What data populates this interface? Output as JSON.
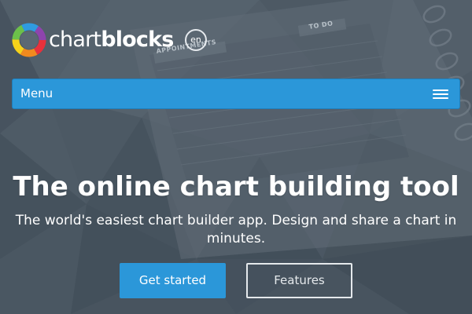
{
  "header": {
    "logo": {
      "text_light": "chart",
      "text_bold": "blocks"
    },
    "language": "en"
  },
  "menu": {
    "label": "Menu",
    "toggle_icon": "hamburger-icon"
  },
  "hero": {
    "title": "The online chart building tool",
    "subtitle": "The world's easiest chart builder app. Design and share a chart in minutes.",
    "background_labels": [
      "APPOINTMENTS",
      "TO DO"
    ]
  },
  "actions": {
    "primary_label": "Get started",
    "secondary_label": "Features"
  },
  "colors": {
    "accent": "#2b97d9",
    "background": "#5b6873",
    "text": "#ffffff"
  }
}
